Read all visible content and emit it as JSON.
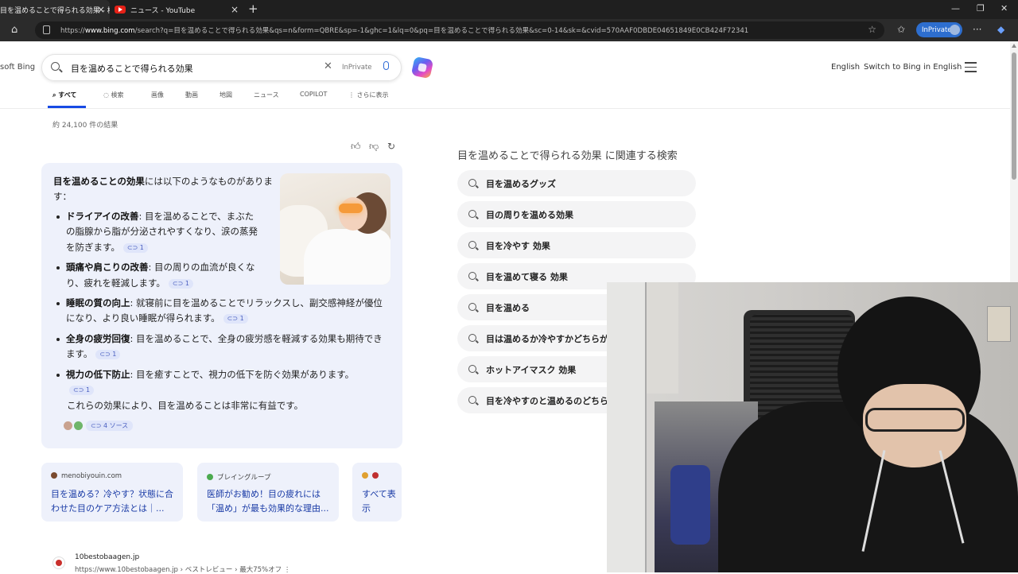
{
  "browser": {
    "tabs": [
      {
        "title": "目を温めることで得られる効果 - 検索"
      },
      {
        "title": "ニュース - YouTube"
      }
    ],
    "url_prefix": "https://",
    "url_host": "www.bing.com",
    "url_rest": "/search?q=目を温めることで得られる効果&qs=n&form=QBRE&sp=-1&ghc=1&lq=0&pq=目を温めることで得られる効果&sc=0-14&sk=&cvid=570AAF0DBDE04651849E0CB424F72341",
    "inprivate_label": "InPrivate"
  },
  "header": {
    "brand": "soft Bing",
    "query": "目を温めることで得られる効果",
    "inprivate_tag": "InPrivate",
    "english": "English",
    "switch": "Switch to Bing in English"
  },
  "nav": {
    "tabs": [
      "すべて",
      "検索",
      "画像",
      "動画",
      "地図",
      "ニュース",
      "COPILOT",
      "さらに表示"
    ]
  },
  "result_count": "約 24,100 件の結果",
  "answer": {
    "intro_bold": "目を温めることの効果",
    "intro_rest": "には以下のようなものがあります：",
    "items": [
      {
        "bold": "ドライアイの改善",
        "text": ": 目を温めることで、まぶたの脂腺から脂が分泌されやすくなり、涙の蒸発を防ぎます。",
        "cite": "⊂⊃ 1"
      },
      {
        "bold": "頭痛や肩こりの改善",
        "text": ": 目の周りの血流が良くなり、疲れを軽減します。",
        "cite": "⊂⊃ 1"
      },
      {
        "bold": "睡眠の質の向上",
        "text": ": 就寝前に目を温めることでリラックスし、副交感神経が優位になり、より良い睡眠が得られます。",
        "cite": "⊂⊃ 1"
      },
      {
        "bold": "全身の疲労回復",
        "text": ": 目を温めることで、全身の疲労感を軽減する効果も期待できます。",
        "cite": "⊂⊃ 1"
      },
      {
        "bold": "視力の低下防止",
        "text": ": 目を癒すことで、視力の低下を防ぐ効果があります。",
        "cite": "⊂⊃ 1"
      }
    ],
    "conclusion": "これらの効果により、目を温めることは非常に有益です。",
    "sources_label": "⊂⊃ 4 ソース"
  },
  "source_cards": [
    {
      "domain": "menobiyouin.com",
      "title": "目を温める？冷やす？状態に合わせた目のケア方法とは｜..."
    },
    {
      "domain": "ブレイングループ",
      "title": "医師がお勧め！目の疲れには「温め」が最も効果的な理由..."
    },
    {
      "domain": "",
      "title": "すべて表示"
    }
  ],
  "result": {
    "site": "10bestobaagen.jp",
    "url": "https://www.10bestobaagen.jp › ベストレビュー › 最大75%オフ ⋮"
  },
  "related": {
    "title": "目を温めることで得られる効果 に関連する検索",
    "items": [
      "目を温めるグッズ",
      "目の周りを温める効果",
      "目を冷やす 効果",
      "目を温めて寝る 効果",
      "目を温める",
      "目は温めるか冷やすかどちらが",
      "ホットアイマスク 効果",
      "目を冷やすのと温めるのどちら"
    ]
  },
  "colors": {
    "accent": "#174ae4",
    "inprivate": "#2d6ecf",
    "card_bg": "#eef1fb"
  }
}
